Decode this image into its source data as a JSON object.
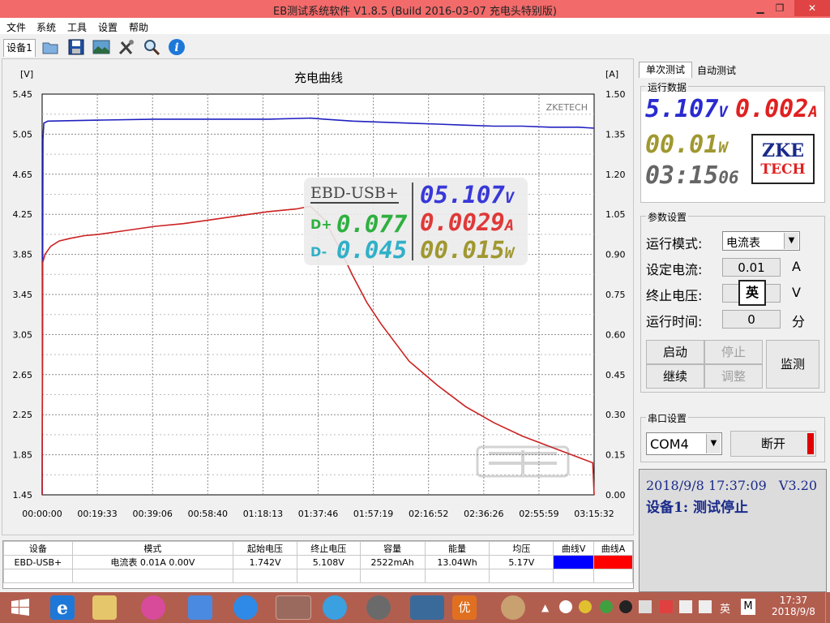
{
  "window": {
    "title": "EB测试系统软件 V1.8.5 (Build 2016-03-07 充电头特别版)"
  },
  "menu": [
    "文件",
    "系统",
    "工具",
    "设置",
    "帮助"
  ],
  "toolbar": {
    "device_tab": "设备1",
    "icons": [
      "open-icon",
      "save-icon",
      "image-icon",
      "tools-icon",
      "search-icon",
      "info-icon"
    ]
  },
  "chart": {
    "title": "充电曲线",
    "left_unit": "[V]",
    "right_unit": "[A]",
    "watermark": "ZKETECH",
    "left_ticks": [
      "5.45",
      "5.05",
      "4.65",
      "4.25",
      "3.85",
      "3.45",
      "3.05",
      "2.65",
      "2.25",
      "1.85",
      "1.45"
    ],
    "right_ticks": [
      "1.50",
      "1.35",
      "1.20",
      "1.05",
      "0.90",
      "0.75",
      "0.60",
      "0.45",
      "0.30",
      "0.15",
      "0.00"
    ],
    "x_ticks": [
      "00:00:00",
      "00:19:33",
      "00:39:06",
      "00:58:40",
      "01:18:13",
      "01:37:46",
      "01:57:19",
      "02:16:52",
      "02:36:26",
      "02:55:59",
      "03:15:32"
    ]
  },
  "chart_data": {
    "type": "line",
    "title": "充电曲线",
    "xlabel": "",
    "ylabel": "[V]",
    "y2label": "[A]",
    "ylim": [
      1.45,
      5.45
    ],
    "y2lim": [
      0.0,
      1.5
    ],
    "xlim_minutes": [
      0,
      195.5
    ],
    "series": [
      {
        "axis": "left",
        "color": "#2020c0",
        "x": [
          0,
          0.3,
          0.6,
          2,
          20,
          40,
          60,
          80,
          95,
          100,
          110,
          120,
          130,
          140,
          150,
          160,
          170,
          180,
          190,
          195.5
        ],
        "y": [
          1.45,
          5.0,
          5.16,
          5.18,
          5.19,
          5.2,
          5.2,
          5.2,
          5.21,
          5.2,
          5.18,
          5.17,
          5.16,
          5.15,
          5.14,
          5.13,
          5.13,
          5.12,
          5.12,
          5.11
        ]
      },
      {
        "axis": "right",
        "color": "#cc2020",
        "x": [
          0,
          0.2,
          1,
          3,
          6,
          10,
          15,
          20,
          30,
          40,
          50,
          60,
          70,
          80,
          90,
          95,
          100,
          105,
          110,
          115,
          120,
          125,
          130,
          140,
          150,
          160,
          170,
          180,
          190,
          195,
          195.5
        ],
        "y": [
          0.0,
          0.87,
          0.9,
          0.93,
          0.95,
          0.96,
          0.97,
          0.975,
          0.99,
          1.005,
          1.015,
          1.03,
          1.045,
          1.06,
          1.07,
          1.08,
          1.03,
          0.93,
          0.82,
          0.72,
          0.64,
          0.57,
          0.5,
          0.41,
          0.33,
          0.27,
          0.22,
          0.18,
          0.14,
          0.12,
          0.0
        ]
      }
    ]
  },
  "overlay": {
    "name": "EBD-USB+",
    "voltage": "05.107",
    "voltage_unit": "V",
    "current": "0.0029",
    "current_unit": "A",
    "dplus_label": "D+",
    "dplus": "0.077",
    "dminus_label": "D-",
    "dminus": "0.045",
    "power": "00.015",
    "power_unit": "W"
  },
  "right": {
    "tabs": [
      "单次测试",
      "自动测试"
    ],
    "run_data_label": "运行数据",
    "voltage": "5.107",
    "voltage_unit": "V",
    "current": "0.002",
    "current_unit": "A",
    "power": "00.01",
    "power_unit": "W",
    "time": "03:15",
    "time_sec": "06",
    "logo_top": "ZKE",
    "logo_bottom": "TECH",
    "params_label": "参数设置",
    "mode_label": "运行模式:",
    "mode_value": "电流表",
    "set_current_label": "设定电流:",
    "set_current_value": "0.01",
    "set_current_unit": "A",
    "stop_voltage_label": "终止电压:",
    "stop_voltage_unit": "V",
    "run_time_label": "运行时间:",
    "run_time_value": "0",
    "run_time_unit": "分",
    "ime_popup": "英",
    "btn_start": "启动",
    "btn_stop": "停止",
    "btn_continue": "继续",
    "btn_adjust": "调整",
    "btn_monitor": "监测",
    "serial_label": "串口设置",
    "port_value": "COM4",
    "btn_disconnect": "断开",
    "status_time": "2018/9/8 17:37:09",
    "status_version": "V3.20",
    "status_text": "设备1: 测试停止"
  },
  "table": {
    "headers": [
      "设备",
      "模式",
      "起始电压",
      "终止电压",
      "容量",
      "能量",
      "均压",
      "曲线V",
      "曲线A"
    ],
    "row": [
      "EBD-USB+",
      "电流表  0.01A  0.00V",
      "1.742V",
      "5.108V",
      "2522mAh",
      "13.04Wh",
      "5.17V",
      "",
      ""
    ],
    "curve_colors": [
      "#0000ff",
      "#ff0000"
    ]
  },
  "taskbar": {
    "time": "17:37",
    "date": "2018/9/8",
    "ime": "英"
  }
}
